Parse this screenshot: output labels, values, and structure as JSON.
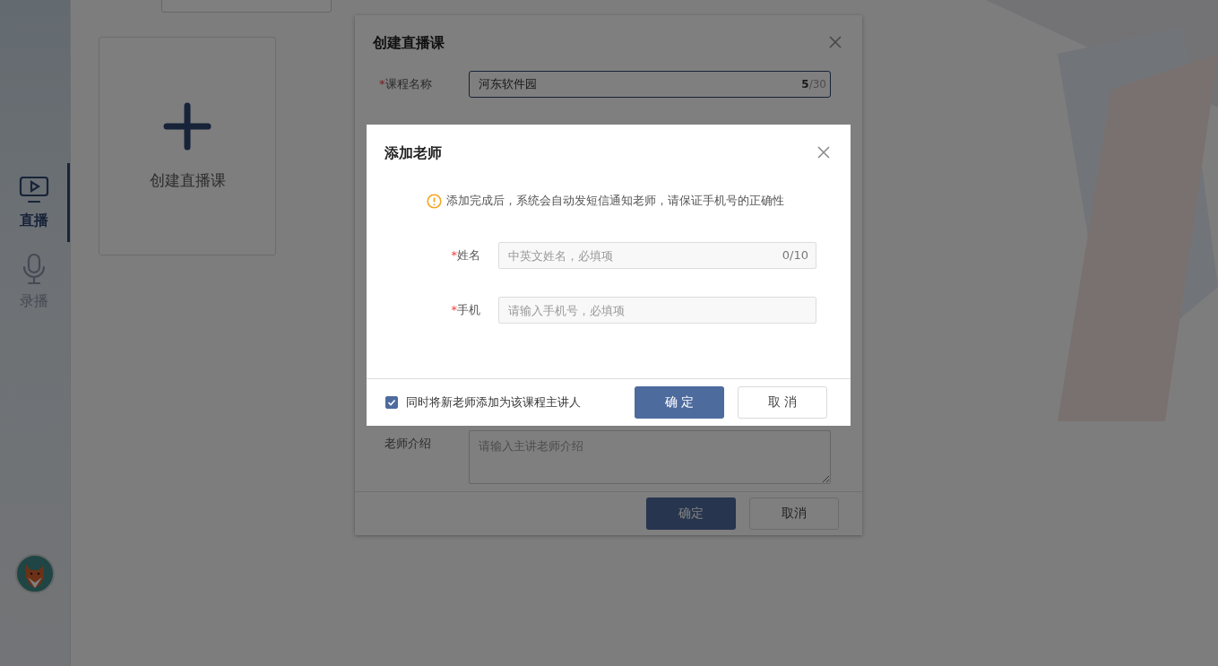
{
  "sidebar": {
    "items": [
      {
        "label": "直播",
        "kind": "live",
        "selected": true
      },
      {
        "label": "录播",
        "kind": "recorded",
        "selected": false
      }
    ]
  },
  "create_card": {
    "label": "创建直播课"
  },
  "course_dialog": {
    "title": "创建直播课",
    "course_name": {
      "required_mark": "*",
      "label": "课程名称",
      "value": "河东软件园",
      "counter": "**5**/30"
    },
    "teacher_intro": {
      "label": "老师介绍",
      "placeholder": "请输入主讲老师介绍"
    },
    "buttons": [
      {
        "label": "确定",
        "kind": "primary"
      },
      {
        "label": "取消",
        "kind": "default"
      }
    ]
  },
  "teacher_dialog": {
    "title": "添加老师",
    "notice": "添加完成后，系统会自动发短信通知老师，请保证手机号的正确性",
    "fields": [
      {
        "required_mark": "*",
        "label": "姓名",
        "placeholder": "中英文姓名，必填项",
        "counter": "0/10"
      },
      {
        "required_mark": "*",
        "label": "手机",
        "placeholder": "请输入手机号，必填项"
      }
    ],
    "set_as_lecturer": {
      "label": "同时将新老师添加为该课程主讲人",
      "checked": true
    },
    "buttons": [
      {
        "label": "确 定",
        "kind": "primary"
      },
      {
        "label": "取 消",
        "kind": "default"
      }
    ]
  }
}
